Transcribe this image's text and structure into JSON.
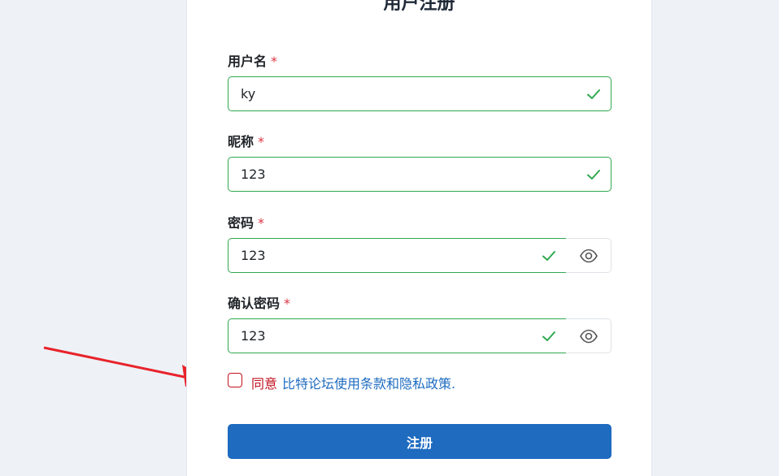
{
  "form": {
    "title": "用户注册",
    "required_mark": "*",
    "fields": [
      {
        "label": "用户名",
        "value": "ky",
        "valid": true
      },
      {
        "label": "昵称",
        "value": "123",
        "valid": true
      },
      {
        "label": "密码",
        "value": "123",
        "valid": true,
        "has_toggle": true
      },
      {
        "label": "确认密码",
        "value": "123",
        "valid": true,
        "has_toggle": true
      }
    ],
    "agree_word": "同意",
    "agree_link": "比特论坛使用条款和隐私政策",
    "agree_suffix": ".",
    "agree_checked": false,
    "submit_label": "注册"
  },
  "icons": {
    "valid": "check-icon",
    "toggle": "eye-icon",
    "annotation": "red-arrow"
  },
  "colors": {
    "valid_border": "#2fa84f",
    "required": "#dc3545",
    "link": "#1e6bc0",
    "button": "#1e6bc0",
    "agree_word": "#c1121f",
    "annotation_arrow": "#e8232b"
  }
}
